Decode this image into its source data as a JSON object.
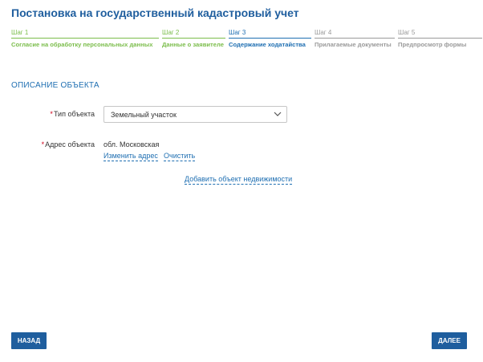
{
  "page": {
    "title": "Постановка на государственный кадастровый учет"
  },
  "steps": [
    {
      "num": "Шаг 1",
      "label": "Согласие на обработку персональных данных",
      "state": "done"
    },
    {
      "num": "Шаг 2",
      "label": "Данные о заявителе",
      "state": "done"
    },
    {
      "num": "Шаг 3",
      "label": "Содержание ходатайства",
      "state": "active"
    },
    {
      "num": "Шаг 4",
      "label": "Прилагаемые документы",
      "state": "todo"
    },
    {
      "num": "Шаг 5",
      "label": "Предпросмотр формы",
      "state": "todo"
    }
  ],
  "section": {
    "title": "ОПИСАНИЕ ОБЪЕКТА"
  },
  "form": {
    "required_mark": "*",
    "object_type": {
      "label": "Тип объекта",
      "value": "Земельный участок"
    },
    "address": {
      "label": "Адрес объекта",
      "value": "обл. Московская",
      "change_link": "Изменить адрес",
      "clear_link": "Очистить"
    },
    "add_property_link": "Добавить объект недвижимости"
  },
  "footer": {
    "back_label": "НАЗАД",
    "next_label": "ДАЛЕЕ"
  },
  "colors": {
    "primary": "#1f5e9e",
    "done": "#7bbd4b",
    "active": "#1f6fb2",
    "todo": "#9a9a9a",
    "required": "#d0021b"
  },
  "icons": {
    "select": "chevron-down-icon"
  }
}
